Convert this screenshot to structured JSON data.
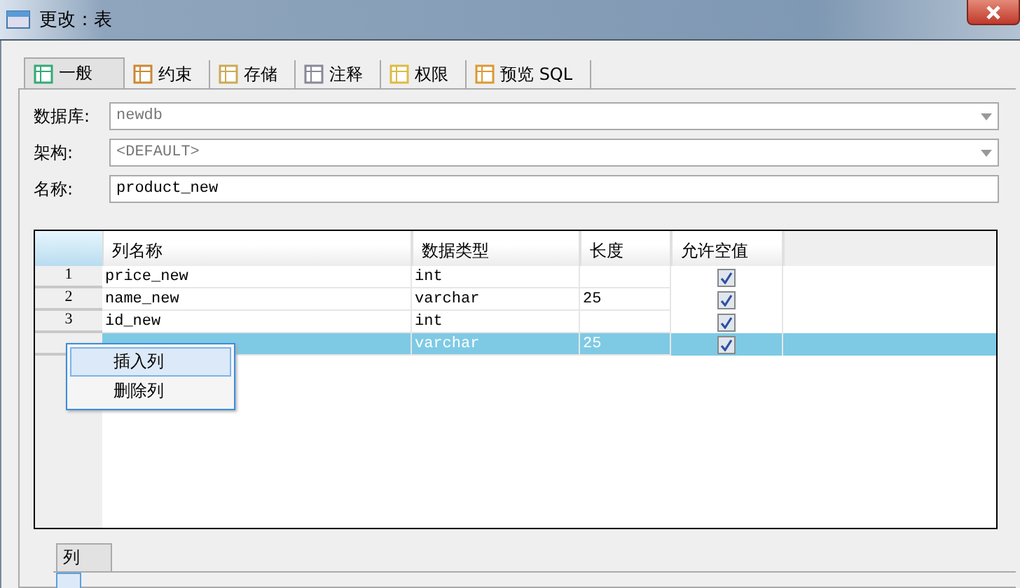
{
  "window": {
    "title": "更改：表"
  },
  "tabs": [
    {
      "label": "一般",
      "selected": true
    },
    {
      "label": "约束",
      "selected": false
    },
    {
      "label": "存储",
      "selected": false
    },
    {
      "label": "注释",
      "selected": false
    },
    {
      "label": "权限",
      "selected": false
    },
    {
      "label": "预览 SQL",
      "selected": false
    }
  ],
  "form": [
    {
      "label": "数据库:",
      "value": "newdb",
      "kind": "dropdown",
      "disabled": true
    },
    {
      "label": "架构:",
      "value": "<DEFAULT>",
      "kind": "dropdown",
      "disabled": true
    },
    {
      "label": "名称:",
      "value": "product_new",
      "kind": "text",
      "disabled": false
    }
  ],
  "table": {
    "columns": [
      "列名称",
      "数据类型",
      "长度",
      "允许空值"
    ],
    "rows": [
      {
        "number": "1",
        "name": "price_new",
        "type": "int",
        "checked": true,
        "selected": false
      },
      {
        "number": "2",
        "name": "name_new",
        "type": "varchar",
        "length": "25",
        "checked": true,
        "selected": false
      },
      {
        "number": "3",
        "name": "id_new",
        "type": "int",
        "checked": true,
        "selected": false
      },
      {
        "type": "varchar",
        "length": "25",
        "checked": true,
        "selected": true
      }
    ]
  },
  "context_menu": [
    {
      "label": "插入列",
      "selected": true
    },
    {
      "label": "删除列",
      "selected": false
    }
  ],
  "bottom_tab": {
    "label": "列"
  }
}
